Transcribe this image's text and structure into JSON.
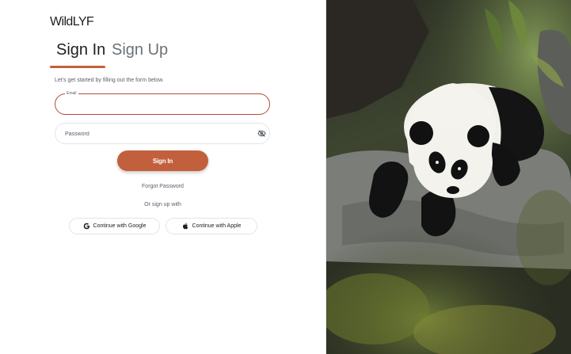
{
  "brand": {
    "name": "WildLYF"
  },
  "tabs": {
    "sign_in": "Sign In",
    "sign_up": "Sign Up",
    "active": "sign_in"
  },
  "form": {
    "subtitle": "Let's get started by filling out the form below.",
    "email": {
      "label": "Email",
      "value": "",
      "state": "focused"
    },
    "password": {
      "placeholder": "Password",
      "value": ""
    },
    "submit_label": "Sign In",
    "forgot_label": "Forgot Password",
    "or_label": "Or sign up with"
  },
  "social": {
    "google_label": "Continue with Google",
    "apple_label": "Continue with Apple"
  },
  "icons": {
    "password_toggle": "eye-off-icon",
    "google": "google-icon",
    "apple": "apple-icon"
  },
  "colors": {
    "accent": "#c2603d",
    "focus_border": "#b04c38",
    "text_primary": "#1f1f1f",
    "text_secondary": "#59606a",
    "border": "#e2e4e8"
  }
}
